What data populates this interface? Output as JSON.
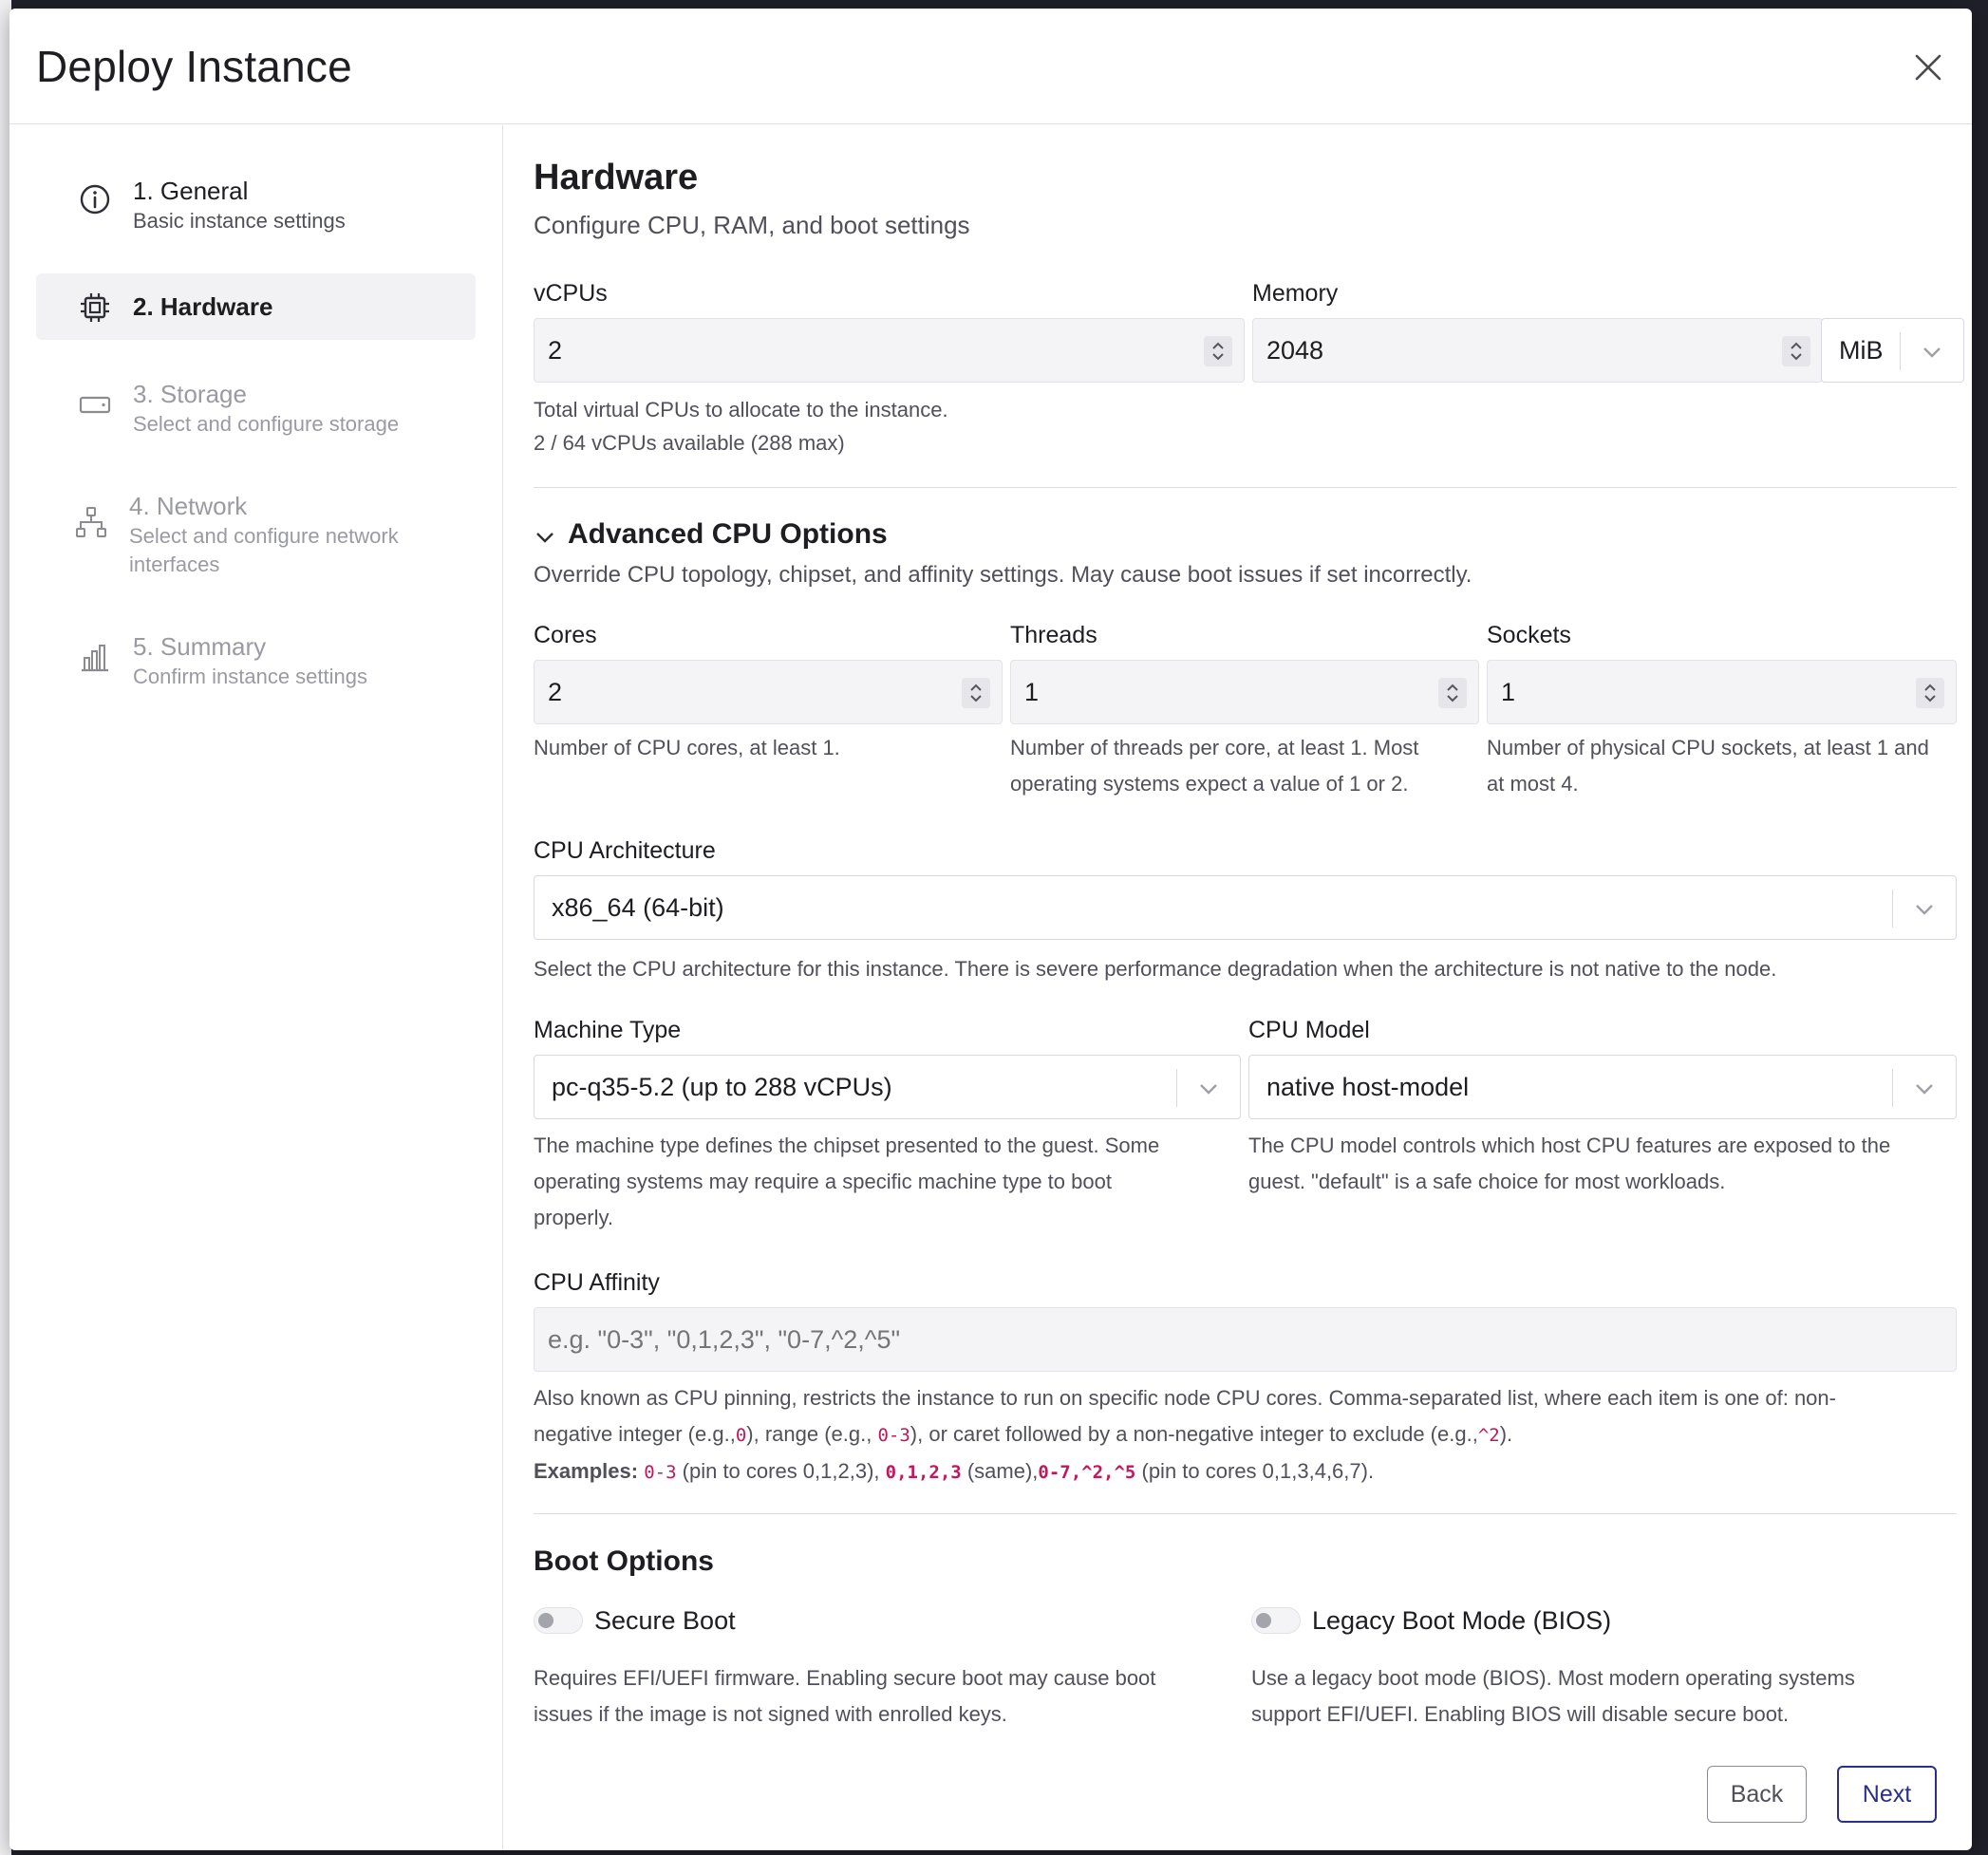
{
  "modal": {
    "title": "Deploy Instance"
  },
  "steps": [
    {
      "label": "1. General",
      "desc": "Basic instance settings"
    },
    {
      "label": "2. Hardware",
      "desc": ""
    },
    {
      "label": "3. Storage",
      "desc": "Select and configure storage"
    },
    {
      "label": "4. Network",
      "desc": "Select and configure network",
      "desc2": "interfaces"
    },
    {
      "label": "5. Summary",
      "desc": "Confirm instance settings"
    }
  ],
  "hardware": {
    "title": "Hardware",
    "subtitle": "Configure CPU, RAM, and boot settings",
    "vcpus": {
      "label": "vCPUs",
      "value": "2",
      "help1": "Total virtual CPUs to allocate to the instance.",
      "help2": "2 / 64 vCPUs available (288 max)"
    },
    "memory": {
      "label": "Memory",
      "value": "2048",
      "unit": "MiB"
    }
  },
  "advanced": {
    "title": "Advanced CPU Options",
    "desc": "Override CPU topology, chipset, and affinity settings. May cause boot issues if set incorrectly.",
    "cores": {
      "label": "Cores",
      "value": "2",
      "help": "Number of CPU cores, at least 1."
    },
    "threads": {
      "label": "Threads",
      "value": "1",
      "help1": "Number of threads per core, at least 1. Most",
      "help2": "operating systems expect a value of 1 or 2."
    },
    "sockets": {
      "label": "Sockets",
      "value": "1",
      "help1": "Number of physical CPU sockets, at least 1 and",
      "help2": "at most 4."
    },
    "arch": {
      "label": "CPU Architecture",
      "value": "x86_64 (64-bit)",
      "help": "Select the CPU architecture for this instance. There is severe performance degradation when the architecture is not native to the node."
    },
    "machine": {
      "label": "Machine Type",
      "value": "pc-q35-5.2 (up to 288 vCPUs)",
      "help1": "The machine type defines the chipset presented to the guest. Some",
      "help2": "operating systems may require a specific machine type to boot",
      "help3": "properly."
    },
    "model": {
      "label": "CPU Model",
      "value": "native host-model",
      "help1": "The CPU model controls which host CPU features are exposed to the",
      "help2": "guest. \"default\" is a safe choice for most workloads."
    },
    "affinity": {
      "label": "CPU Affinity",
      "placeholder": "e.g. \"0-3\", \"0,1,2,3\", \"0-7,^2,^5\"",
      "help_a": "Also known as CPU pinning, restricts the instance to run on specific node CPU cores. Comma-separated list, where each item is one of: non-",
      "help_b1": "negative integer (e.g.,",
      "code_int": "0",
      "help_b2": "), range (e.g.,",
      "code_range": "0-3",
      "help_b3": "), or caret followed by a non-negative integer to exclude (e.g.,",
      "code_caret": "^2",
      "help_b4": ").",
      "examples_label": "Examples:",
      "ex1": "0-3",
      "ex1_desc": "(pin to cores 0,1,2,3),",
      "ex2": "0,1,2,3",
      "ex2_desc": "(same),",
      "ex3": "0-7,^2,^5",
      "ex3_desc": "(pin to cores 0,1,3,4,6,7)."
    }
  },
  "boot": {
    "title": "Boot Options",
    "secure": {
      "label": "Secure Boot",
      "help1": "Requires EFI/UEFI firmware. Enabling secure boot may cause boot",
      "help2": "issues if the image is not signed with enrolled keys."
    },
    "legacy": {
      "label": "Legacy Boot Mode (BIOS)",
      "help1": "Use a legacy boot mode (BIOS). Most modern operating systems",
      "help2": "support EFI/UEFI. Enabling BIOS will disable secure boot."
    }
  },
  "footer": {
    "back": "Back",
    "next": "Next"
  },
  "colors": {
    "accent": "#2b2f8a",
    "code": "#c2185b",
    "input_bg": "#f4f4f6"
  }
}
